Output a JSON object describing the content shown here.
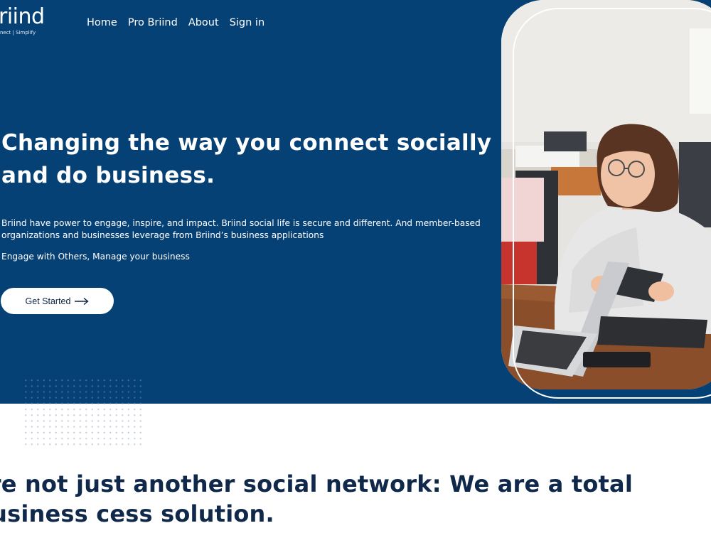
{
  "brand": {
    "logo_text": "riind",
    "tagline": "nect | Simplify"
  },
  "nav": {
    "items": [
      "Home",
      "Pro Briind",
      "About",
      "Sign in"
    ]
  },
  "hero": {
    "headline": "Changing the way you connect socially and do business.",
    "description": "Briind have power to engage, inspire, and impact. Briind social life is secure and different. And member-based organizations and businesses leverage from Briind’s business applications",
    "subtext": "Engage with Others, Manage your business",
    "cta_label": "Get Started"
  },
  "section": {
    "title": "are not just another social network: We are a total business cess solution."
  },
  "colors": {
    "hero_bg": "#064176",
    "heading_dark": "#10294a",
    "cta_bg": "#ffffff"
  },
  "icons": {
    "cta_arrow": "arrow-right-icon"
  }
}
